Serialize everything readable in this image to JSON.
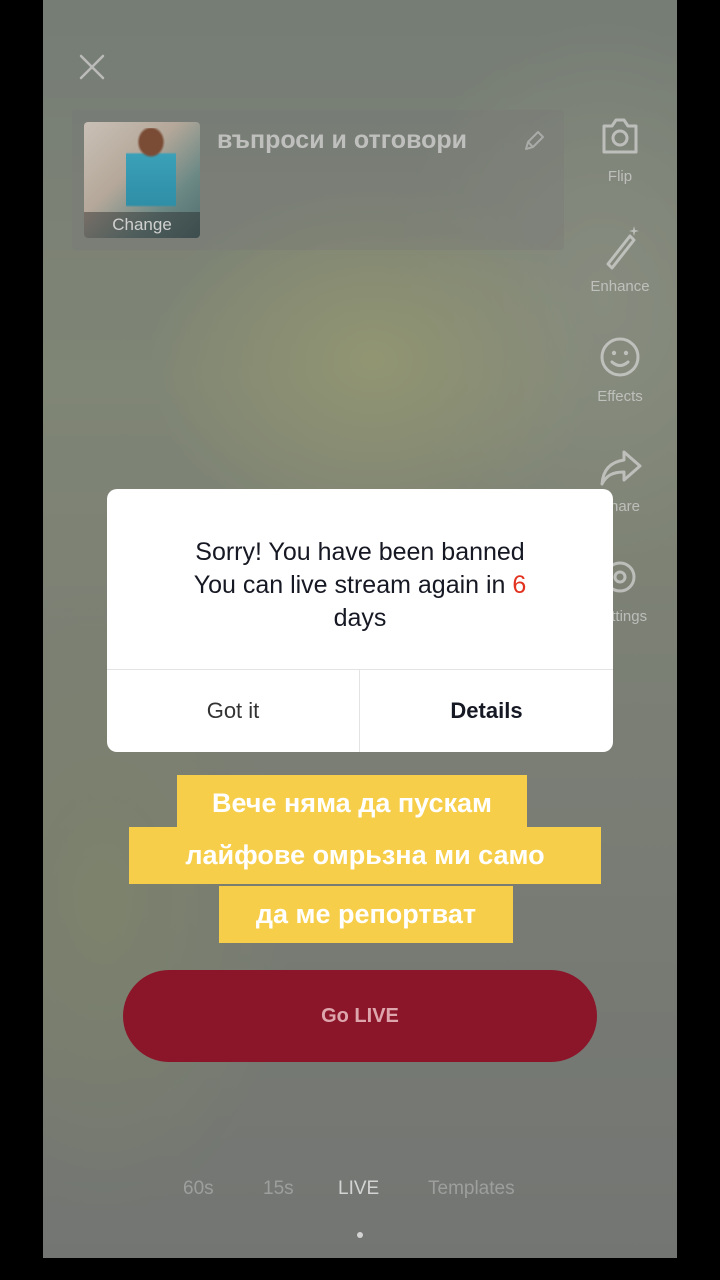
{
  "live_setup": {
    "title": "въпроси и отговори",
    "cover_change_label": "Change"
  },
  "tools": {
    "flip": "Flip",
    "enhance": "Enhance",
    "effects": "Effects",
    "share": "Share",
    "settings": "Settings"
  },
  "dialog": {
    "line1": "Sorry! You have been banned",
    "line2_prefix": "You can live stream again in ",
    "days_value": "6",
    "line3": "days",
    "accent_color": "#e2321f",
    "got_it": "Got it",
    "details": "Details"
  },
  "caption": {
    "line1": "Вече няма да пускам",
    "line2": "лайфове  омрьзна ми само",
    "line3": "да ме репортват",
    "background_color": "#f6ce4a"
  },
  "go_live": {
    "label": "Go LIVE",
    "color": "#8b1529"
  },
  "modes": [
    "60s",
    "15s",
    "LIVE",
    "Templates"
  ],
  "active_mode": "LIVE"
}
